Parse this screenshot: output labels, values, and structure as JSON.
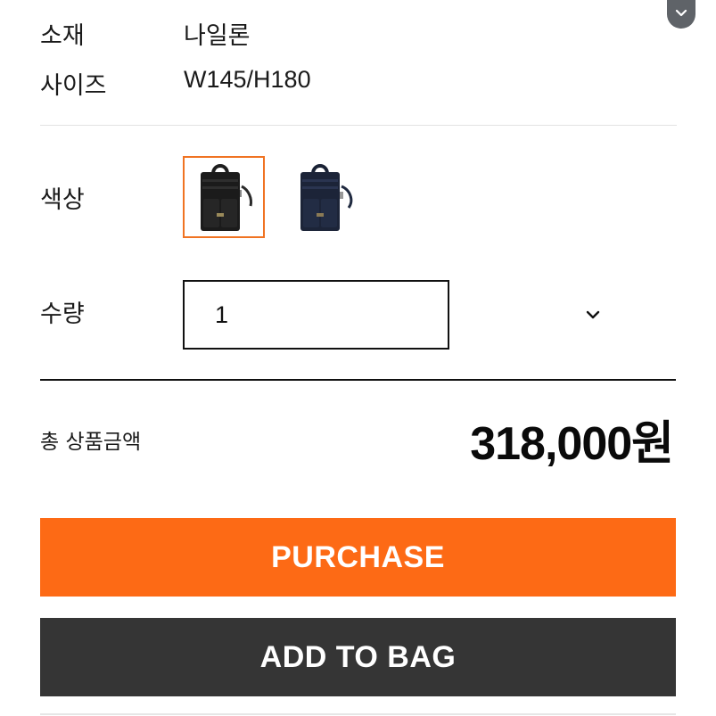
{
  "product_info": {
    "material_label": "소재",
    "material_value": "나일론",
    "size_label": "사이즈",
    "size_value": "W145/H180"
  },
  "options": {
    "color_label": "색상",
    "color_swatches": [
      {
        "name": "black",
        "selected": true
      },
      {
        "name": "navy",
        "selected": false
      }
    ],
    "quantity_label": "수량",
    "quantity_value": "1"
  },
  "total": {
    "label": "총 상품금액",
    "price": "318,000원"
  },
  "actions": {
    "purchase_label": "PURCHASE",
    "add_to_bag_label": "ADD TO BAG"
  },
  "colors": {
    "accent_orange": "#fd6a15",
    "selected_border": "#f07322",
    "dark_button": "#353535"
  },
  "icons": {
    "scroll": "chevron-down-icon",
    "select": "chevron-down-icon"
  }
}
